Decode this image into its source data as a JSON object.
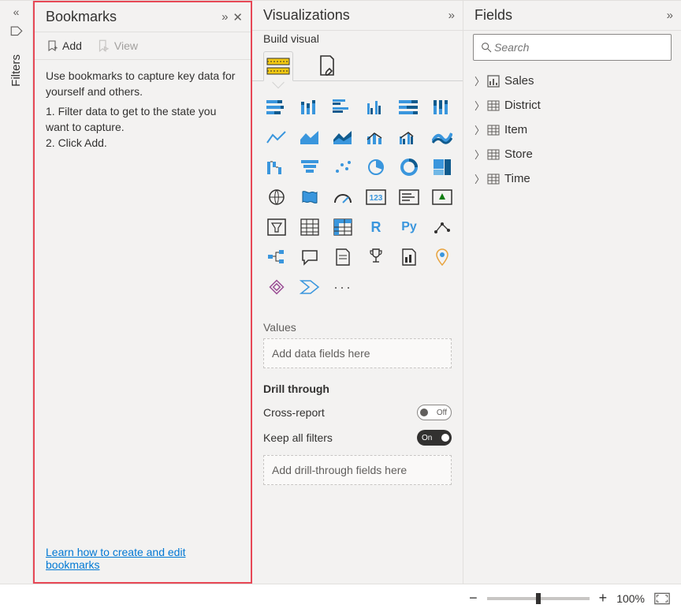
{
  "filters": {
    "label": "Filters"
  },
  "bookmarks": {
    "title": "Bookmarks",
    "add": "Add",
    "view": "View",
    "intro": "Use bookmarks to capture key data for yourself and others.",
    "step1": "1. Filter data to get to the state you want to capture.",
    "step2": "2. Click Add.",
    "link": "Learn how to create and edit bookmarks"
  },
  "viz": {
    "title": "Visualizations",
    "subtitle": "Build visual",
    "values_label": "Values",
    "values_placeholder": "Add data fields here",
    "drill_label": "Drill through",
    "cross_report": "Cross-report",
    "cross_report_state": "Off",
    "keep_filters": "Keep all filters",
    "keep_filters_state": "On",
    "drill_placeholder": "Add drill-through fields here",
    "more": "···",
    "r_label": "R",
    "py_label": "Py"
  },
  "fields": {
    "title": "Fields",
    "search_placeholder": "Search",
    "items": [
      {
        "label": "Sales",
        "type": "measure"
      },
      {
        "label": "District",
        "type": "table"
      },
      {
        "label": "Item",
        "type": "table"
      },
      {
        "label": "Store",
        "type": "table"
      },
      {
        "label": "Time",
        "type": "table"
      }
    ]
  },
  "zoom": {
    "minus": "−",
    "plus": "+",
    "percent": "100%"
  }
}
